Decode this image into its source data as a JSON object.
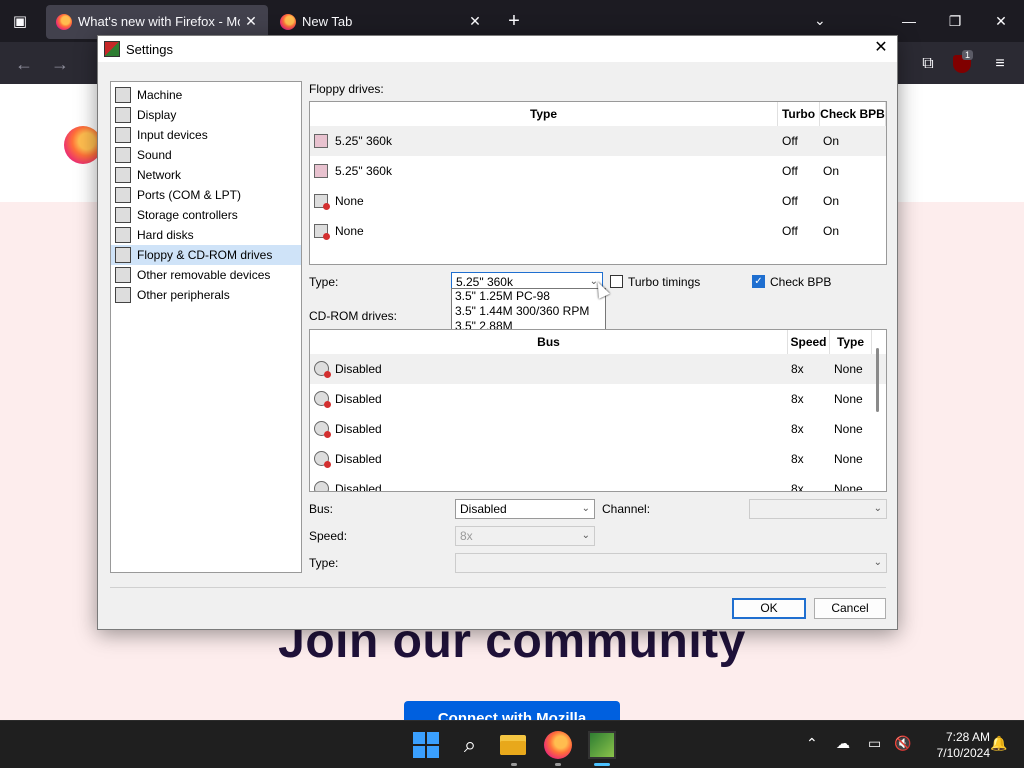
{
  "browser": {
    "tabs": [
      {
        "title": "What's new with Firefox - More"
      },
      {
        "title": "New Tab"
      }
    ],
    "extension_badge": "1"
  },
  "page": {
    "heading": "Join our community",
    "cta": "Connect with Mozilla"
  },
  "dialog": {
    "title": "Settings",
    "nav": [
      "Machine",
      "Display",
      "Input devices",
      "Sound",
      "Network",
      "Ports (COM & LPT)",
      "Storage controllers",
      "Hard disks",
      "Floppy & CD-ROM drives",
      "Other removable devices",
      "Other peripherals"
    ],
    "floppy": {
      "section_label": "Floppy drives:",
      "headers": {
        "type": "Type",
        "turbo": "Turbo",
        "check_bpb": "Check BPB"
      },
      "rows": [
        {
          "type": "5.25\" 360k",
          "turbo": "Off",
          "check_bpb": "On"
        },
        {
          "type": "5.25\" 360k",
          "turbo": "Off",
          "check_bpb": "On"
        },
        {
          "type": "None",
          "turbo": "Off",
          "check_bpb": "On"
        },
        {
          "type": "None",
          "turbo": "Off",
          "check_bpb": "On"
        }
      ],
      "type_label": "Type:",
      "type_value": "5.25\" 360k",
      "type_options": [
        "3.5\" 1.25M PC-98",
        "3.5\" 1.44M 300/360 RPM",
        "3.5\" 2.88M"
      ],
      "turbo_label": "Turbo timings",
      "turbo_checked": false,
      "check_bpb_label": "Check BPB",
      "check_bpb_checked": true
    },
    "cdrom": {
      "section_label": "CD-ROM drives:",
      "headers": {
        "bus": "Bus",
        "speed": "Speed",
        "type": "Type"
      },
      "rows": [
        {
          "bus": "Disabled",
          "speed": "8x",
          "type": "None"
        },
        {
          "bus": "Disabled",
          "speed": "8x",
          "type": "None"
        },
        {
          "bus": "Disabled",
          "speed": "8x",
          "type": "None"
        },
        {
          "bus": "Disabled",
          "speed": "8x",
          "type": "None"
        },
        {
          "bus": "Disabled",
          "speed": "8x",
          "type": "None"
        }
      ],
      "bus_label": "Bus:",
      "bus_value": "Disabled",
      "channel_label": "Channel:",
      "speed_label": "Speed:",
      "speed_value": "8x",
      "type_label": "Type:"
    },
    "ok": "OK",
    "cancel": "Cancel"
  },
  "taskbar": {
    "time": "7:28 AM",
    "date": "7/10/2024"
  }
}
